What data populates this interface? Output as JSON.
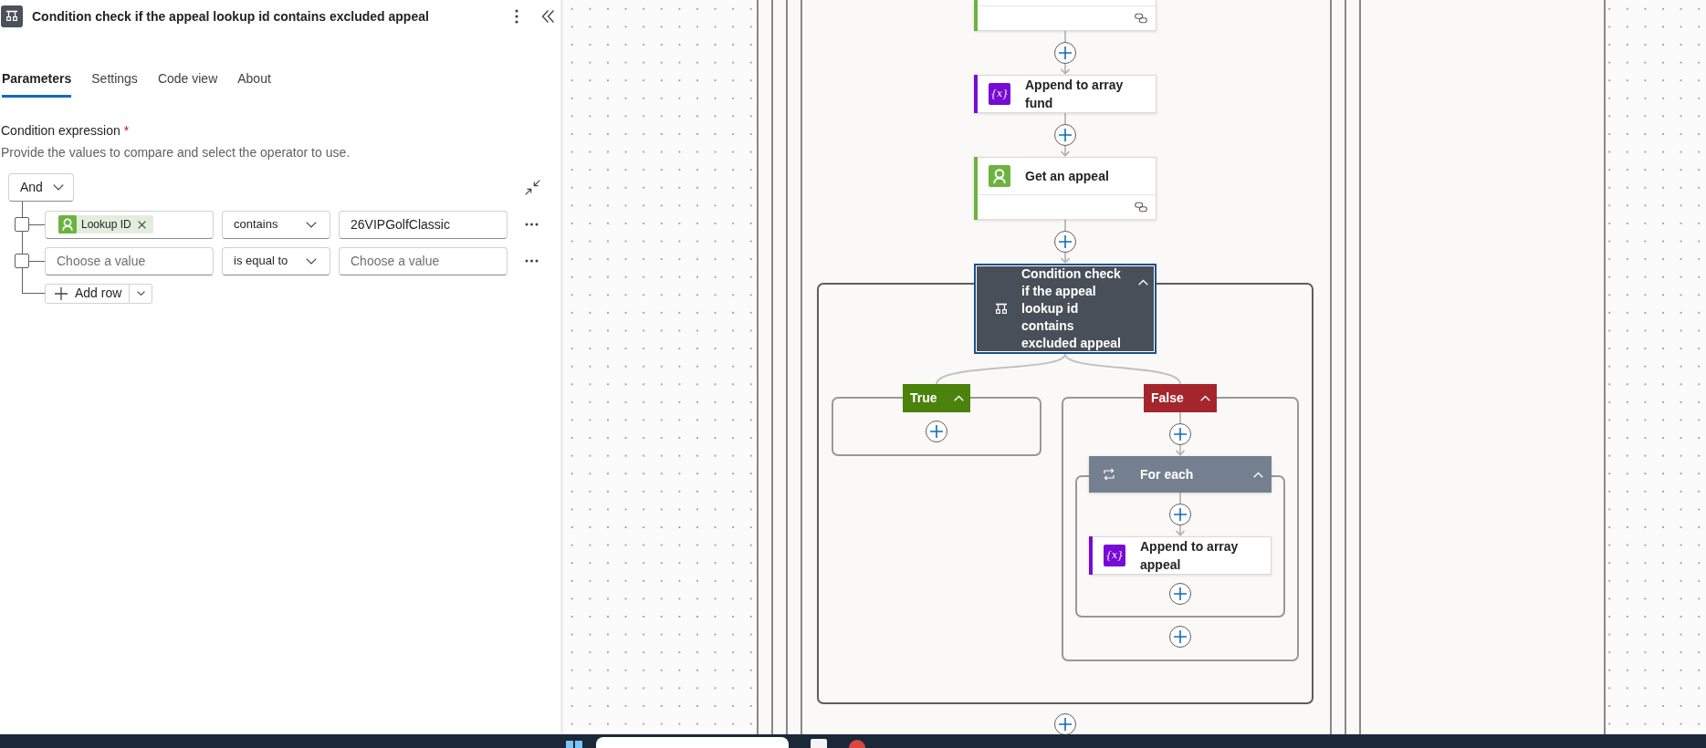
{
  "panel": {
    "title": "Condition check if the appeal lookup id contains excluded appeal",
    "tabs": [
      {
        "label": "Parameters",
        "selected": true
      },
      {
        "label": "Settings",
        "selected": false
      },
      {
        "label": "Code view",
        "selected": false
      },
      {
        "label": "About",
        "selected": false
      }
    ],
    "field_label": "Condition expression",
    "required_mark": "*",
    "hint": "Provide the values to compare and select the operator to use.",
    "group_operator": "And",
    "rows": [
      {
        "checked": false,
        "left": {
          "kind": "token",
          "label": "Lookup ID"
        },
        "operator": "contains",
        "right": {
          "kind": "value",
          "value": "26VIPGolfClassic"
        }
      },
      {
        "checked": false,
        "left": {
          "kind": "empty",
          "placeholder": "Choose a value"
        },
        "operator": "is equal to",
        "right": {
          "kind": "empty",
          "placeholder": "Choose a value"
        }
      }
    ],
    "add_row": "Add row"
  },
  "canvas": {
    "steps": [
      {
        "kind": "connector_action",
        "selected": false,
        "color": "#6cb33f"
      },
      {
        "kind": "variable_action",
        "title": "Append to array fund",
        "icon_glyph": "{x}",
        "selected": false,
        "color": "#770bd6"
      },
      {
        "kind": "connector_action",
        "title": "Get an appeal",
        "selected": false,
        "color": "#6cb33f"
      },
      {
        "kind": "condition",
        "title": "Condition check if the appeal lookup id contains excluded appeal",
        "selected": true,
        "expanded": true,
        "branches": [
          {
            "label": "True",
            "color": "#4b820c",
            "expanded": true
          },
          {
            "label": "False",
            "color": "#a4262c",
            "expanded": true,
            "steps": [
              {
                "kind": "foreach",
                "title": "For each",
                "selected": false,
                "expanded": true,
                "steps": [
                  {
                    "kind": "variable_action",
                    "title": "Append to array appeal",
                    "icon_glyph": "{x}",
                    "selected": false,
                    "color": "#770bd6"
                  }
                ]
              }
            ]
          }
        ]
      }
    ]
  }
}
